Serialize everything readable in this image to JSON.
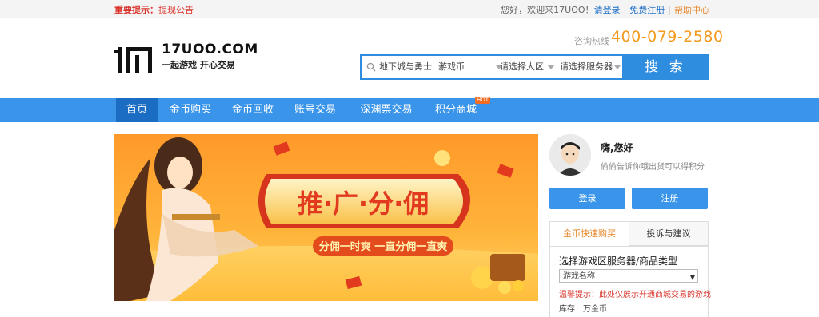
{
  "topbar": {
    "notice_label": "重要提示：",
    "notice_link": "提现公告",
    "welcome": "您好，欢迎来17UOO！",
    "login": "请登录",
    "register": "免费注册",
    "help": "帮助中心"
  },
  "header": {
    "logo_domain": "17UOO.COM",
    "logo_slogan": "一起游戏  开心交易",
    "hotline_label": "咨询热线",
    "hotline_number": "400-079-2580"
  },
  "search": {
    "game": "地下城与勇士",
    "type": "游戏币",
    "region": "请选择大区",
    "server": "请选择服务器",
    "button": "搜 索"
  },
  "nav": {
    "items": [
      "首页",
      "金币购买",
      "金币回收",
      "账号交易",
      "深渊票交易",
      "积分商城"
    ],
    "active_index": 0,
    "hot_badge": "HOT"
  },
  "banner": {
    "headline": "推·广·分·佣",
    "tagline": "分佣一时爽  一直分佣一直爽"
  },
  "user_panel": {
    "greeting": "嗨,您好",
    "tip": "偷偷告诉你哦出货可以得积分",
    "login_button": "登录",
    "register_button": "注册",
    "tabs": [
      "金币快速购买",
      "投诉与建议"
    ],
    "active_tab": 0,
    "form_title": "选择游戏区服务器/商品类型",
    "game_select": "游戏名称",
    "warning": "温馨提示：此处仅展示开通商城交易的游戏",
    "stock": "库存：万金币"
  },
  "colors": {
    "nav_blue": "#3a95ea",
    "nav_active": "#1b6dc4",
    "accent_orange": "#f39a1e",
    "warn_red": "#d9342b"
  }
}
